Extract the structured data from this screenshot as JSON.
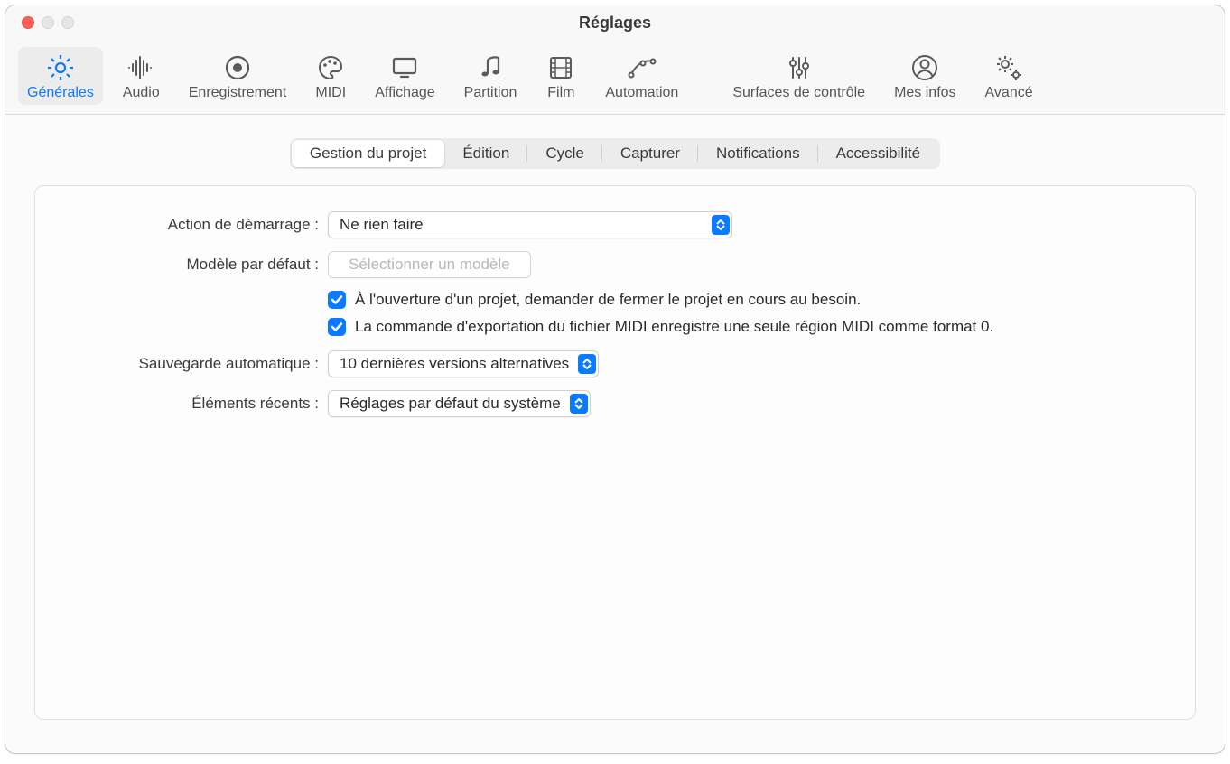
{
  "window": {
    "title": "Réglages"
  },
  "toolbar": [
    {
      "id": "generales",
      "label": "Générales",
      "icon": "gear",
      "selected": true
    },
    {
      "id": "audio",
      "label": "Audio",
      "icon": "wave",
      "selected": false
    },
    {
      "id": "enreg",
      "label": "Enregistrement",
      "icon": "record",
      "selected": false
    },
    {
      "id": "midi",
      "label": "MIDI",
      "icon": "palette",
      "selected": false
    },
    {
      "id": "affichage",
      "label": "Affichage",
      "icon": "display",
      "selected": false
    },
    {
      "id": "partition",
      "label": "Partition",
      "icon": "notes",
      "selected": false
    },
    {
      "id": "film",
      "label": "Film",
      "icon": "film",
      "selected": false
    },
    {
      "id": "automation",
      "label": "Automation",
      "icon": "curve",
      "selected": false
    },
    {
      "id": "surfaces",
      "label": "Surfaces de contrôle",
      "icon": "sliders",
      "selected": false
    },
    {
      "id": "mesinfos",
      "label": "Mes infos",
      "icon": "person",
      "selected": false
    },
    {
      "id": "avance",
      "label": "Avancé",
      "icon": "gears",
      "selected": false
    }
  ],
  "sub_tabs": [
    {
      "label": "Gestion du projet",
      "selected": true
    },
    {
      "label": "Édition",
      "selected": false
    },
    {
      "label": "Cycle",
      "selected": false
    },
    {
      "label": "Capturer",
      "selected": false
    },
    {
      "label": "Notifications",
      "selected": false
    },
    {
      "label": "Accessibilité",
      "selected": false
    }
  ],
  "form": {
    "startup_action": {
      "label": "Action de démarrage :",
      "value": "Ne rien faire"
    },
    "default_model": {
      "label": "Modèle par défaut :",
      "button": "Sélectionner un modèle"
    },
    "check1": {
      "label": "À l'ouverture d'un projet, demander de fermer le projet en cours au besoin.",
      "checked": true
    },
    "check2": {
      "label": "La commande d'exportation du fichier MIDI enregistre une seule région MIDI comme format 0.",
      "checked": true
    },
    "autosave": {
      "label": "Sauvegarde automatique :",
      "value": "10 dernières versions alternatives"
    },
    "recent": {
      "label": "Éléments récents :",
      "value": "Réglages par défaut du système"
    }
  }
}
